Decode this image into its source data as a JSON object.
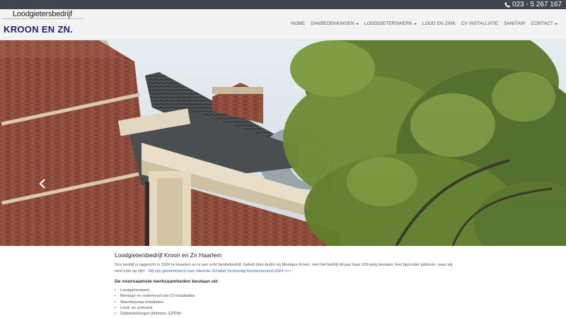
{
  "topbar": {
    "phone": "023 - 5 267 167"
  },
  "brand": {
    "tagline": "Loodgietersbedrijf",
    "name": "KROON EN ZN."
  },
  "nav": {
    "items": [
      {
        "label": "HOME",
        "dropdown": false
      },
      {
        "label": "DAKBEDEKKINGEN",
        "dropdown": true
      },
      {
        "label": "LOODGIETERSWERK",
        "dropdown": true
      },
      {
        "label": "LOOD EN ZINK",
        "dropdown": false
      },
      {
        "label": "CV INSTALLATIE",
        "dropdown": false
      },
      {
        "label": "SANITAIR",
        "dropdown": false
      },
      {
        "label": "CONTACT",
        "dropdown": true
      }
    ]
  },
  "content": {
    "title": "Loodgietersbedrijf Kroon en Zn Haarlem",
    "intro": "Ons bedrijf is opgericht in 1924 te Haarlem en is een echt familiebedrijf. Geleid door André en Monique Kroon, viert het bedrijf dit jaar haar 100-jarig bestaan. Een bijzonder jubileum, waar wij heel trots op zijn!",
    "intro_link": "Wij zijn genomineerd voor Sterkste Schakel Verkiezing Kennemerland 2024 >>>",
    "services_heading": "De voornaamste werkzaamheden bestaan uit:",
    "services": [
      "Loodgieterswerk",
      "Montage en onderhoud van CV-installaties",
      "Warmtepomp installaties",
      "Lood- en zinkwerk",
      "Dakbedekkingen (bitumen, EPDM)"
    ]
  },
  "colors": {
    "topbar": "#3f4650",
    "brand": "#1f1f7a",
    "link": "#3366cc"
  }
}
